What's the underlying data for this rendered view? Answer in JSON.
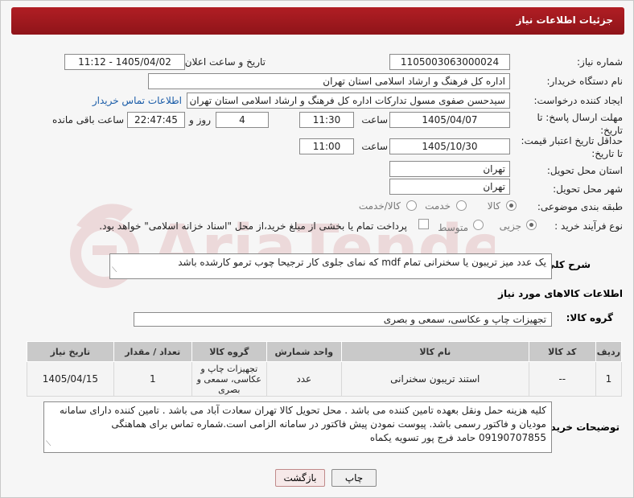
{
  "header": {
    "title": "جزئیات اطلاعات نیاز"
  },
  "fields": {
    "need_number_label": "شماره نیاز:",
    "need_number": "1105003063000024",
    "announce_label": "تاریخ و ساعت اعلان عمومی:",
    "announce_value": "1405/04/02 - 11:12",
    "buyer_org_label": "نام دستگاه خریدار:",
    "buyer_org": "اداره کل فرهنگ و ارشاد اسلامی استان تهران",
    "requester_label": "ایجاد کننده درخواست:",
    "requester": "سیدحسن صفوی مسول تدارکات اداره کل فرهنگ و ارشاد اسلامی استان تهران",
    "buyer_contact_link": "اطلاعات تماس خریدار",
    "reply_deadline_label": "مهلت ارسال پاسخ: تا تاریخ:",
    "reply_date": "1405/04/07",
    "time_label": "ساعت",
    "reply_time": "11:30",
    "days_value": "4",
    "days_label": "روز و",
    "remaining_time": "22:47:45",
    "remaining_label": "ساعت باقی مانده",
    "price_validity_label": "حداقل تاریخ اعتبار قیمت: تا تاریخ:",
    "price_date": "1405/10/30",
    "price_time_label": "ساعت",
    "price_time": "11:00",
    "province_label": "استان محل تحویل:",
    "province": "تهران",
    "city_label": "شهر محل تحویل:",
    "city": "تهران",
    "category_label": "طبقه بندی موضوعی:",
    "category_options": [
      "کالا",
      "خدمت",
      "کالا/خدمت"
    ],
    "category_selected": "کالا",
    "process_label": "نوع فرآیند خرید :",
    "process_options": [
      "جزیی",
      "متوسط"
    ],
    "process_selected": "جزیی",
    "treasury_note": "پرداخت تمام یا بخشی از مبلغ خرید،از محل \"اسناد خزانه اسلامی\" خواهد بود."
  },
  "description": {
    "label": "شرح کلی نیاز:",
    "text": "یک عدد میز تریبون  یا سخنرانی  تمام mdf که نمای جلوی کار ترجیحا چوب ترمو کارشده باشد"
  },
  "goods": {
    "section_title": "اطلاعات کالاهای مورد نیاز",
    "group_label": "گروه کالا:",
    "group_value": "تجهیزات چاپ و عکاسی، سمعی و بصری",
    "table": {
      "headers": [
        "ردیف",
        "کد کالا",
        "نام کالا",
        "واحد شمارش",
        "گروه کالا",
        "تعداد / مقدار",
        "تاریخ نیاز"
      ],
      "rows": [
        [
          "1",
          "--",
          "استند تریبون سخنرانی",
          "عدد",
          "تجهیزات چاپ و عکاسی، سمعی و بصری",
          "1",
          "1405/04/15"
        ]
      ]
    }
  },
  "buyer_notes": {
    "label": "توضیحات خریدار:",
    "text": "کلیه هزینه حمل ونقل  بعهده تامین کننده می باشد . محل تحویل کالا تهران سعادت آباد می باشد . تامین کننده دارای سامانه مودیان و فاکتور رسمی باشد. پیوست نمودن پیش فاکتور در سامانه الزامی است.شماره تماس برای هماهنگی 09190707855 حامد فرج پور تسویه یکماه"
  },
  "buttons": {
    "print": "چاپ",
    "back": "بازگشت"
  },
  "watermark": {
    "text": "AriaTender.net"
  }
}
